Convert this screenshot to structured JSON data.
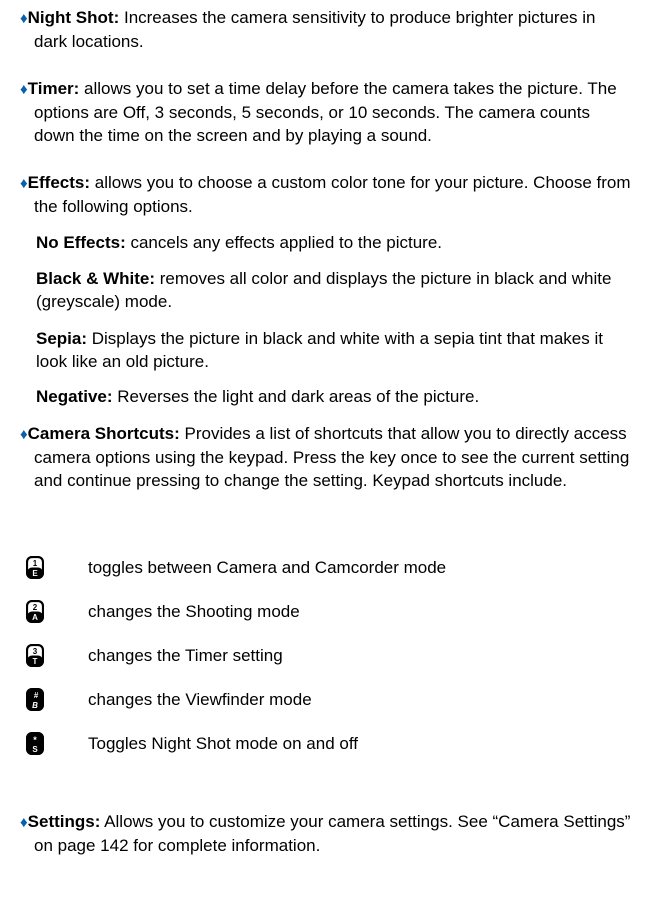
{
  "bullet_glyph": "♦",
  "bullet_color": "#0a5fae",
  "items": [
    {
      "label": "Night Shot:",
      "text": " Increases the camera sensitivity to produce brighter pictures in dark locations."
    },
    {
      "label": "Timer:",
      "text": " allows you to set a time delay before the camera takes the picture. The options are Off, 3 seconds, 5 seconds, or 10 seconds. The camera counts down the time on the screen and by playing a sound."
    },
    {
      "label": "Effects:",
      "text": " allows you to choose a custom color tone for your picture. Choose from the following options."
    },
    {
      "label": "Camera Shortcuts:",
      "text": " Provides a list of shortcuts that allow you to directly access camera options using the keypad. Press the key once to see the current setting and continue pressing to change the setting. Keypad shortcuts include."
    },
    {
      "label": "Settings:",
      "text": " Allows you to customize your camera settings. See “Camera Settings” on page 142 for complete information."
    }
  ],
  "effects": [
    {
      "label": "No Effects:",
      "text": " cancels any effects applied to the picture."
    },
    {
      "label": "Black & White:",
      "text": " removes all color and displays the picture in black and white (greyscale) mode."
    },
    {
      "label": "Sepia:",
      "text": " Displays the picture in black and white with a sepia tint that makes it look like an old picture."
    },
    {
      "label": "Negative:",
      "text": " Reverses the light and dark areas of the picture."
    }
  ],
  "shortcuts": [
    {
      "key_top": "1",
      "key_bottom": "E",
      "icon": "key-1-icon",
      "text": "toggles between Camera and Camcorder mode"
    },
    {
      "key_top": "2",
      "key_bottom": "A",
      "icon": "key-2-icon",
      "text": "changes the Shooting mode"
    },
    {
      "key_top": "3",
      "key_bottom": "T",
      "icon": "key-3-icon",
      "text": "changes the Timer setting"
    },
    {
      "key_top": "#",
      "key_bottom": "B",
      "icon": "key-hash-icon",
      "text": "changes the Viewfinder mode"
    },
    {
      "key_top": "*",
      "key_bottom": "S",
      "icon": "key-star-icon",
      "text": "Toggles Night Shot mode on and off"
    }
  ]
}
